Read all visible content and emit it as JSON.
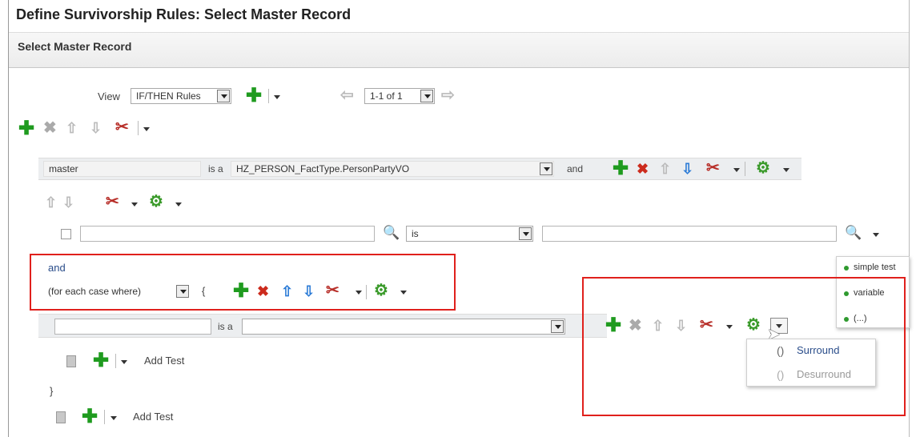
{
  "page": {
    "title": "Define Survivorship Rules: Select Master Record",
    "subtitle": "Select Master Record"
  },
  "view_bar": {
    "view_label": "View",
    "view_value": "IF/THEN Rules",
    "pagination_value": "1-1 of 1"
  },
  "rule_row": {
    "field_value": "master",
    "is_a_label": "is a",
    "type_value": "HZ_PERSON_FactType.PersonPartyVO",
    "and_label": "and"
  },
  "test_row": {
    "operator_value": "is"
  },
  "case_block": {
    "and_label": "and",
    "case_select_value": "(for each case where)",
    "open_brace": "{",
    "is_a_label": "is a",
    "add_test_label": "Add Test",
    "close_brace": "}"
  },
  "outer_add_test_label": "Add Test",
  "side_menu": {
    "items": [
      "simple test",
      "variable",
      "(...)"
    ]
  },
  "gear_menu": {
    "items": [
      {
        "label": "Surround",
        "enabled": true
      },
      {
        "label": "Desurround",
        "enabled": false
      }
    ]
  },
  "colors": {
    "highlight_red": "#e0201c",
    "add_green": "#1f9b1f",
    "delete_red": "#cc2b1d"
  }
}
